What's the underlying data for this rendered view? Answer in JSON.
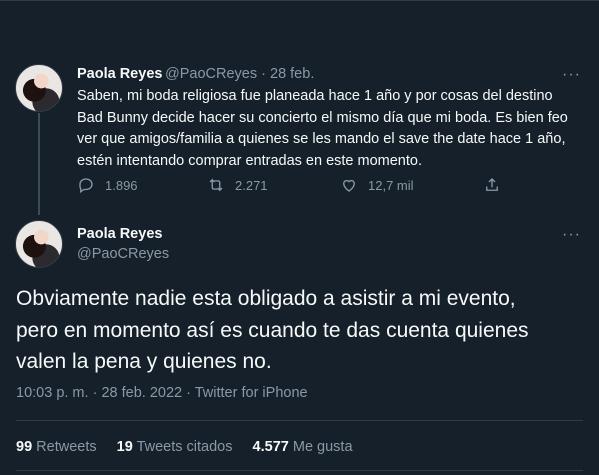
{
  "parent_tweet": {
    "display_name": "Paola Reyes",
    "handle": "@PaoCReyes",
    "separator": "·",
    "date": "28 feb.",
    "more": "···",
    "lines": [
      "Saben, mi boda religiosa fue planeada hace 1 año y por cosas del destino",
      "Bad Bunny decide hacer su concierto el mismo día que mi boda. Es bien feo",
      "ver que amigos/familia a quienes se les mando el save the date hace 1 año,",
      "estén intentando comprar entradas en este momento."
    ],
    "replies": "1.896",
    "retweets": "2.271",
    "likes": "12,7 mil",
    "icons": [
      "reply-icon",
      "retweet-icon",
      "like-icon",
      "share-icon"
    ]
  },
  "main_tweet": {
    "display_name": "Paola Reyes",
    "handle": "@PaoCReyes",
    "more": "···",
    "lines": [
      "Obviamente nadie esta obligado a asistir a mi evento,",
      "pero en momento así es cuando te das cuenta quienes",
      "valen la pena y quienes no."
    ],
    "time": "10:03 p. m.",
    "sep": "·",
    "date": "28 feb. 2022",
    "source": "Twitter for iPhone",
    "stats": {
      "retweets_count": "99",
      "retweets_label": "Retweets",
      "quotes_count": "19",
      "quotes_label": "Tweets citados",
      "likes_count": "4.577",
      "likes_label": "Me gusta"
    }
  },
  "colors": {
    "background": "#15202b",
    "text": "#f7f9f9",
    "muted": "#8b98a5",
    "divider": "#2f3b47"
  }
}
